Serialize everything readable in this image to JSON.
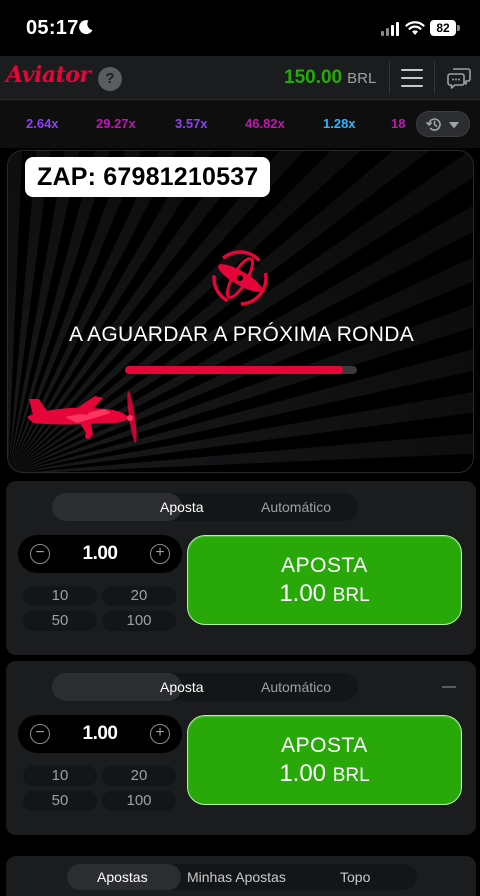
{
  "status_bar": {
    "time": "05:17",
    "battery": "82",
    "icons": [
      "moon-icon",
      "signal-icon",
      "wifi-icon",
      "battery-icon"
    ]
  },
  "header": {
    "logo": "Aviator",
    "help": "?",
    "balance": "150.00",
    "currency": "BRL",
    "brand_color": "#e50539",
    "balance_color": "#28a909"
  },
  "history": {
    "multipliers": [
      {
        "value": "2.64x",
        "color": "#913ef8"
      },
      {
        "value": "29.27x",
        "color": "#c017b4"
      },
      {
        "value": "3.57x",
        "color": "#913ef8"
      },
      {
        "value": "46.82x",
        "color": "#c017b4"
      },
      {
        "value": "1.28x",
        "color": "#34b4ff"
      },
      {
        "value": "18",
        "color": "#c017b4"
      }
    ]
  },
  "game": {
    "overlay_text": "ZAP: 67981210537",
    "status": "A AGUARDAR A PRÓXIMA RONDA",
    "progress": 0.94
  },
  "bet_panels": [
    {
      "tabs": [
        "Aposta",
        "Automático"
      ],
      "active_tab": "Aposta",
      "amount": "1.00",
      "quick_amounts": [
        "10",
        "20",
        "50",
        "100"
      ],
      "button_label": "APOSTA",
      "button_amount": "1.00",
      "button_currency": "BRL"
    },
    {
      "tabs": [
        "Aposta",
        "Automático"
      ],
      "active_tab": "Aposta",
      "amount": "1.00",
      "quick_amounts": [
        "10",
        "20",
        "50",
        "100"
      ],
      "button_label": "APOSTA",
      "button_amount": "1.00",
      "button_currency": "BRL"
    }
  ],
  "bottom_tabs": {
    "items": [
      "Apostas",
      "Minhas Apostas",
      "Topo"
    ],
    "active": "Apostas"
  }
}
